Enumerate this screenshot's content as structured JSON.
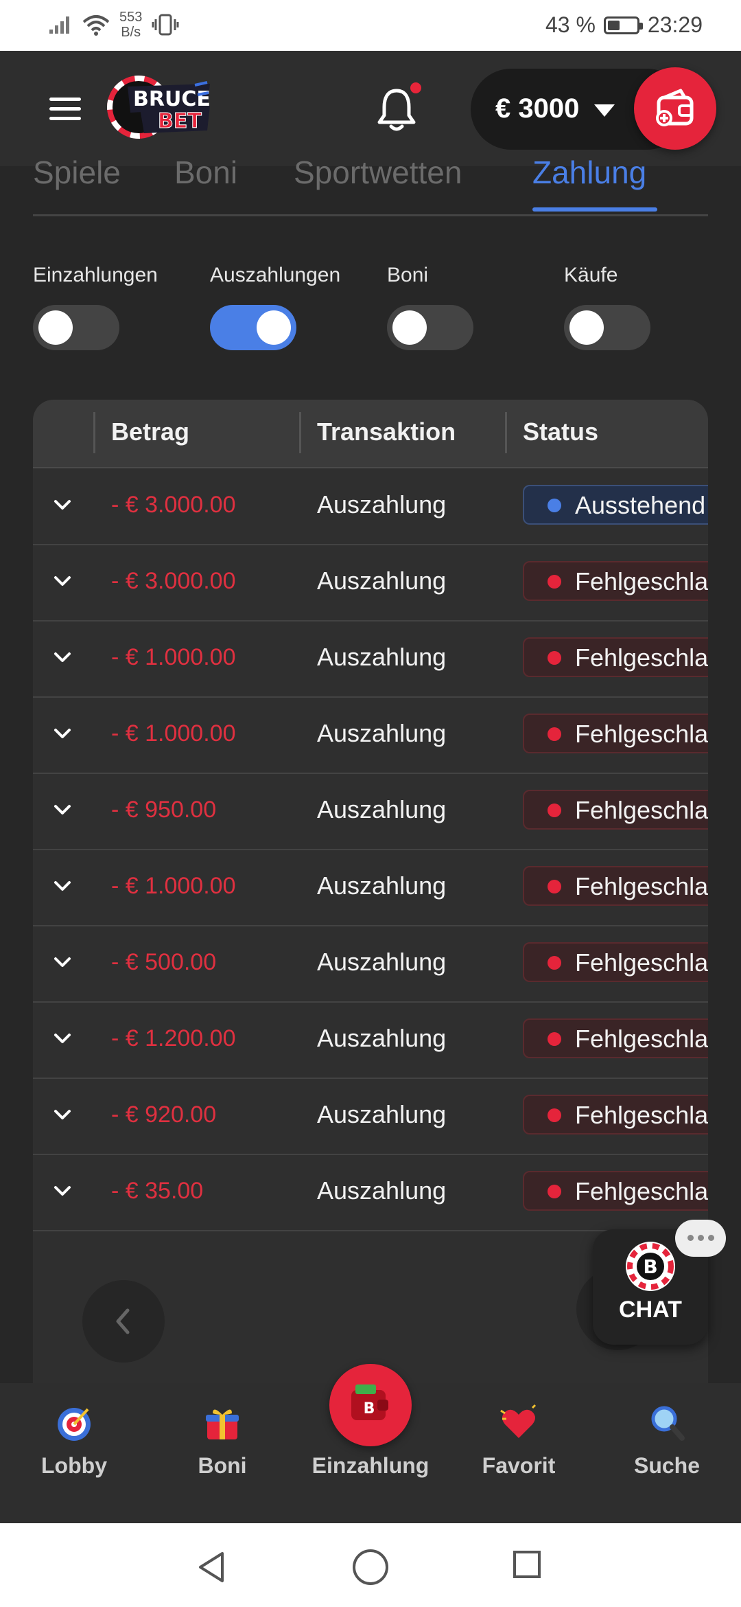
{
  "status_bar": {
    "net_speed_value": "553",
    "net_speed_unit": "B/s",
    "battery": "43 %",
    "time": "23:29"
  },
  "header": {
    "logo_text_top": "BRUCE",
    "logo_text_bottom": "BET",
    "balance": "€ 3000"
  },
  "tabs": [
    {
      "label": "Spiele"
    },
    {
      "label": "Boni"
    },
    {
      "label": "Sportwetten"
    },
    {
      "label": "Zahlung"
    }
  ],
  "filters": [
    {
      "label": "Einzahlungen",
      "on": false
    },
    {
      "label": "Auszahlungen",
      "on": true
    },
    {
      "label": "Boni",
      "on": false
    },
    {
      "label": "Käufe",
      "on": false
    }
  ],
  "table": {
    "headers": [
      "Betrag",
      "Transaktion",
      "Status"
    ],
    "rows": [
      {
        "amount": "- € 3.000.00",
        "transaction": "Auszahlung",
        "status": "Ausstehend"
      },
      {
        "amount": "- € 3.000.00",
        "transaction": "Auszahlung",
        "status": "Fehlgeschla"
      },
      {
        "amount": "- € 1.000.00",
        "transaction": "Auszahlung",
        "status": "Fehlgeschla"
      },
      {
        "amount": "- € 1.000.00",
        "transaction": "Auszahlung",
        "status": "Fehlgeschla"
      },
      {
        "amount": "- € 950.00",
        "transaction": "Auszahlung",
        "status": "Fehlgeschla"
      },
      {
        "amount": "- € 1.000.00",
        "transaction": "Auszahlung",
        "status": "Fehlgeschla"
      },
      {
        "amount": "- € 500.00",
        "transaction": "Auszahlung",
        "status": "Fehlgeschla"
      },
      {
        "amount": "- € 1.200.00",
        "transaction": "Auszahlung",
        "status": "Fehlgeschla"
      },
      {
        "amount": "- € 920.00",
        "transaction": "Auszahlung",
        "status": "Fehlgeschla"
      },
      {
        "amount": "- € 35.00",
        "transaction": "Auszahlung",
        "status": "Fehlgeschla"
      }
    ]
  },
  "chat": {
    "label": "CHAT",
    "logo_letter": "B"
  },
  "bottom_nav": [
    {
      "label": "Lobby",
      "icon": "target-icon"
    },
    {
      "label": "Boni",
      "icon": "gift-icon"
    },
    {
      "label": "Einzahlung",
      "icon": "wallet-icon"
    },
    {
      "label": "Favorit",
      "icon": "heart-icon"
    },
    {
      "label": "Suche",
      "icon": "magnifier-icon"
    }
  ],
  "colors": {
    "accent_blue": "#4a7fe6",
    "brand_red": "#e5243b",
    "amount_red": "#e03040",
    "background": "#272727"
  }
}
